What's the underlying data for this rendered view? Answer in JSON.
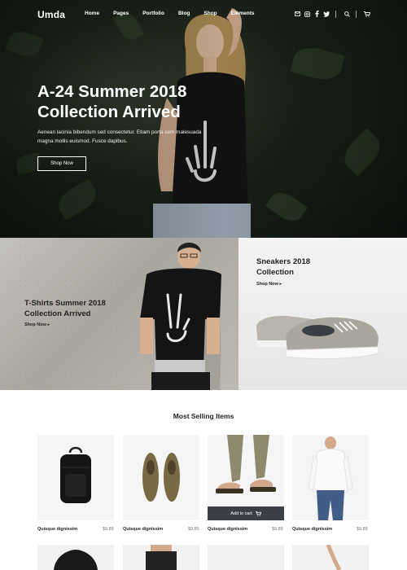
{
  "nav": {
    "logo": "Umda",
    "menu": [
      "Home",
      "Pages",
      "Portfolio",
      "Blog",
      "Shop",
      "Elements"
    ],
    "icons": [
      "mail-icon",
      "instagram-icon",
      "facebook-icon",
      "twitter-icon",
      "search-icon",
      "cart-icon"
    ]
  },
  "hero": {
    "title": "A-24 Summer 2018 Collection Arrived",
    "text": "Aenean lacinia bibendum sed consectetur. Etiam porta sem malesuada magna mollis euismod. Fusce dapibus.",
    "button": "Shop Now"
  },
  "promos": [
    {
      "title": "T-Shirts Summer 2018 Collection Arrived",
      "link": "Shop Now ▸"
    },
    {
      "title": "Sneakers 2018 Collection",
      "link": "Shop Now ▸"
    }
  ],
  "section_title": "Most Selling Items",
  "products": [
    {
      "name": "Quisque dignissim",
      "price": "$9.85"
    },
    {
      "name": "Quisque dignissim",
      "price": "$9.85"
    },
    {
      "name": "Quisque dignissim",
      "price": "$9.85",
      "cart_label": "Add to cart"
    },
    {
      "name": "Quisque dignissim",
      "price": "$9.85"
    }
  ],
  "colors": {
    "hero_bg": "#1f271d",
    "cart_button": "#3b3f47",
    "text_dark": "#222222",
    "price": "#777777"
  }
}
